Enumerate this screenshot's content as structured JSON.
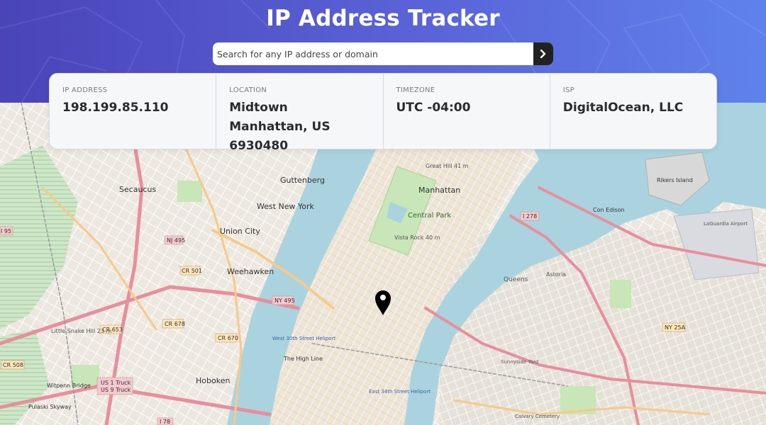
{
  "header": {
    "title": "IP Address Tracker",
    "search_placeholder": "Search for any IP address or domain",
    "search_value": ""
  },
  "info": [
    {
      "label": "IP ADDRESS",
      "value": "198.199.85.110"
    },
    {
      "label": "LOCATION",
      "value": "Midtown Manhattan, US 6930480"
    },
    {
      "label": "TIMEZONE",
      "value": "UTC -04:00"
    },
    {
      "label": "ISP",
      "value": "DigitalOcean, LLC"
    }
  ],
  "map": {
    "labels": [
      "Secaucus",
      "Guttenberg",
      "West New York",
      "Union City",
      "Weehawken",
      "Manhattan",
      "Central Park",
      "Vista Rock 40 m",
      "Great Hill 41 m",
      "Hoboken",
      "Rikers Island",
      "Con Edison",
      "LaGuardia Airport",
      "Queens",
      "Little Snake Hill 23 m",
      "Witpenn Bridge",
      "Pulaski Skyway",
      "The High Line",
      "West 30th Street Heliport",
      "East 34th Street Heliport",
      "Sunnyside Yard",
      "NJ 495",
      "NY 495",
      "CR 501",
      "CR 653",
      "CR 678",
      "CR 670",
      "CR 508",
      "I 278",
      "I 95",
      "NY 25A",
      "US 1 Truck",
      "US 9 Truck",
      "I 78",
      "Calvary Cemetery",
      "Astoria"
    ],
    "marker": "location-pin"
  },
  "colors": {
    "header_start": "#4a44b8",
    "header_end": "#5f82ea",
    "button": "#212121",
    "water": "#aad3df",
    "park": "#c8e6b8",
    "road_major": "#f7c98b",
    "road_highway": "#e88e9c"
  }
}
